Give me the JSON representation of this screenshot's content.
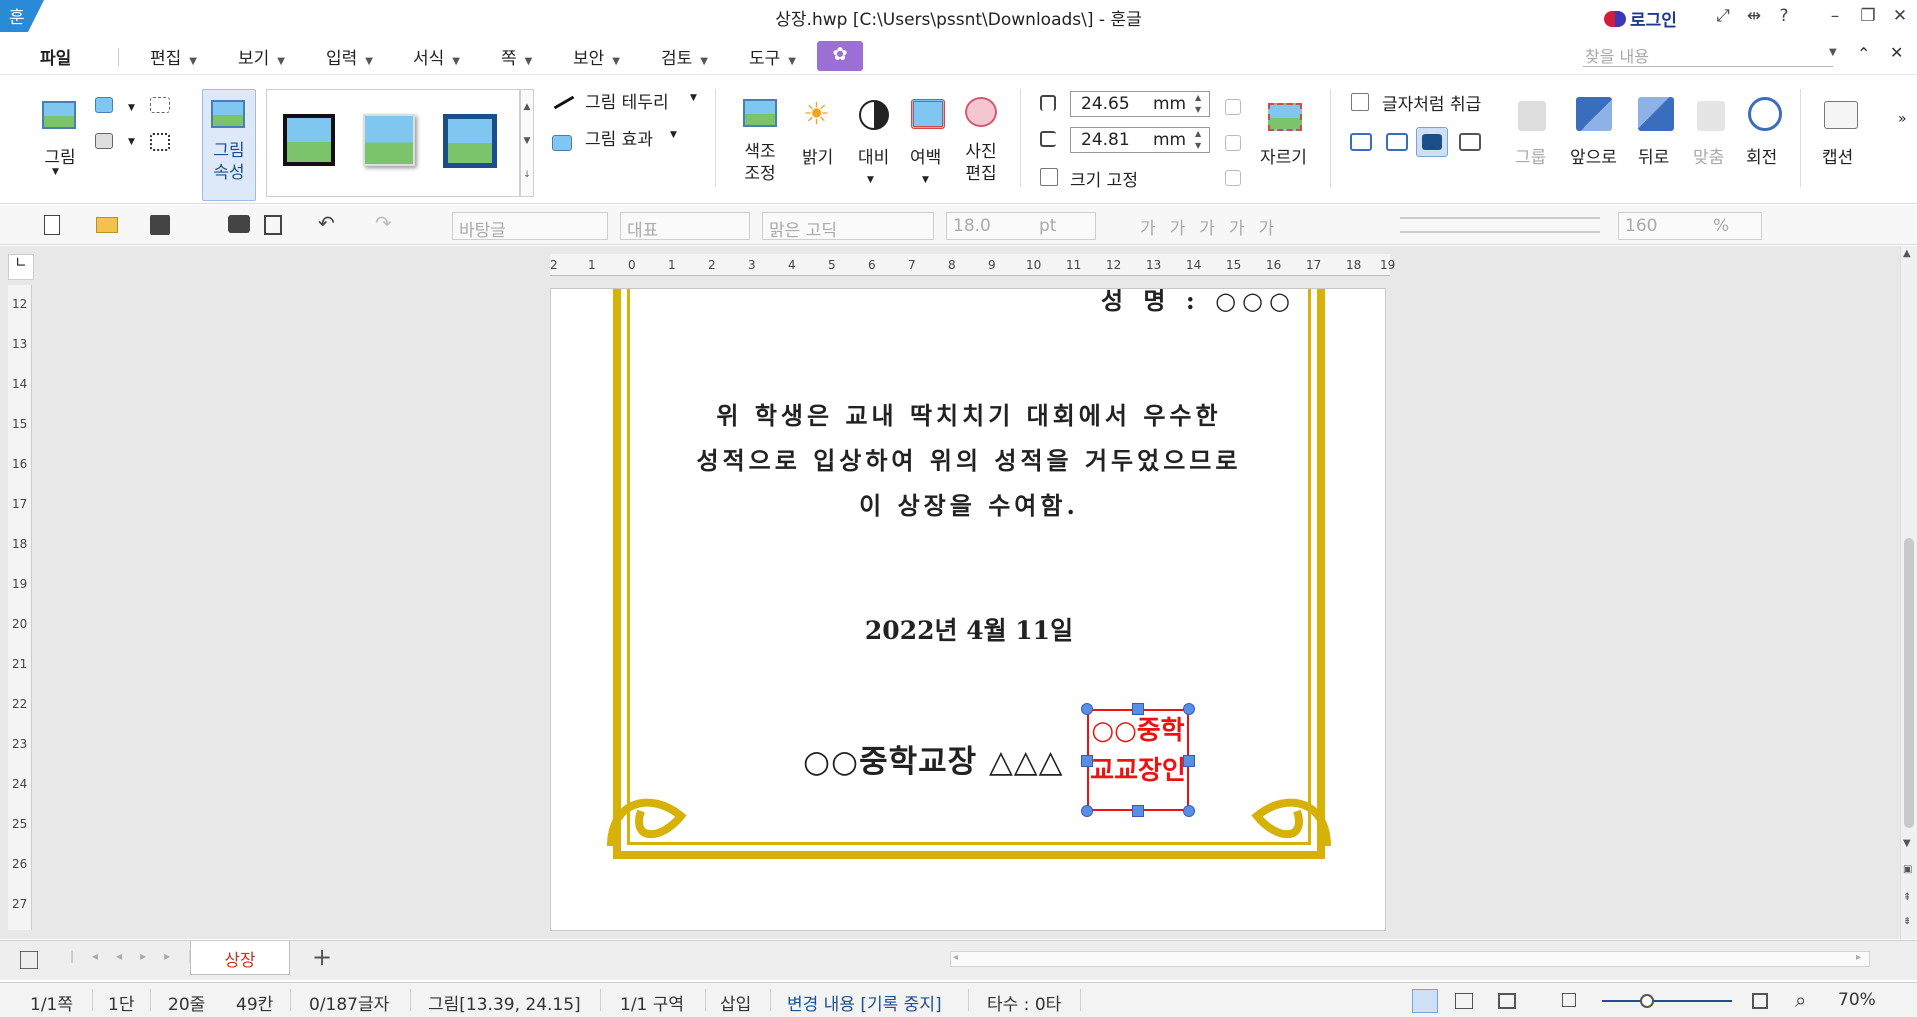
{
  "window": {
    "title": "상장.hwp [C:\\Users\\pssnt\\Downloads\\] - 훈글",
    "app_logo": "훈",
    "login_label": "로그인"
  },
  "menu": {
    "items": [
      "파일",
      "편집",
      "보기",
      "입력",
      "서식",
      "쪽",
      "보안",
      "검토",
      "도구"
    ],
    "search_placeholder": "찾을 내용"
  },
  "ribbon": {
    "picture_label": "그림",
    "picture_props_label": "그림\n속성",
    "border_label": "그림 테두리",
    "effect_label": "그림 효과",
    "color_adjust_label": "색조\n조정",
    "brightness_label": "밝기",
    "contrast_label": "대비",
    "margin_label": "여백",
    "photo_edit_label": "사진\n편집",
    "width_value": "24.65",
    "height_value": "24.81",
    "unit": "mm",
    "lock_size_label": "크기 고정",
    "crop_label": "자르기",
    "treat_as_char_label": "글자처럼 취급",
    "group_label": "그룹",
    "front_label": "앞으로",
    "back_label": "뒤로",
    "align_label": "맞춤",
    "rotate_label": "회전",
    "caption_label": "캡션"
  },
  "format_bar": {
    "style": "바탕글",
    "representative": "대표",
    "font": "맑은 고딕",
    "size": "18.0",
    "size_unit": "pt",
    "zoom": "160",
    "zoom_unit": "%"
  },
  "document": {
    "name_line": "성 명 : ○○○",
    "body_lines": [
      "위 학생은 교내 딱치치기 대회에서 우수한",
      "성적으로 입상하여 위의 성적을 거두었으므로",
      "이 상장을 수여함."
    ],
    "date": "2022년 4월 11일",
    "principal": "○○중학교장 △△△",
    "seal_lines": [
      "○○중학",
      "교교장인"
    ]
  },
  "ruler": {
    "h_ticks": [
      "2",
      "1",
      "0",
      "1",
      "2",
      "3",
      "4",
      "5",
      "6",
      "7",
      "8",
      "9",
      "10",
      "11",
      "12",
      "13",
      "14",
      "15",
      "16",
      "17",
      "18",
      "19"
    ],
    "v_ticks": [
      "12",
      "13",
      "14",
      "15",
      "16",
      "17",
      "18",
      "19",
      "20",
      "21",
      "22",
      "23",
      "24",
      "25",
      "26",
      "27"
    ]
  },
  "tabs": {
    "doc_tab": "상장",
    "add": "+"
  },
  "status": {
    "page": "1/1쪽",
    "column": "1단",
    "line": "20줄",
    "col": "49칸",
    "chars": "0/187글자",
    "object": "그림[13.39, 24.15]",
    "section": "1/1 구역",
    "mode": "삽입",
    "track": "변경 내용 [기록 중지]",
    "typing": "타수 : 0타",
    "zoom": "70%"
  },
  "colors": {
    "frame_gold": "#d6b208",
    "seal_red": "#e11111",
    "handle_blue": "#5b8fe6",
    "login_blue": "#1d3c8f"
  }
}
